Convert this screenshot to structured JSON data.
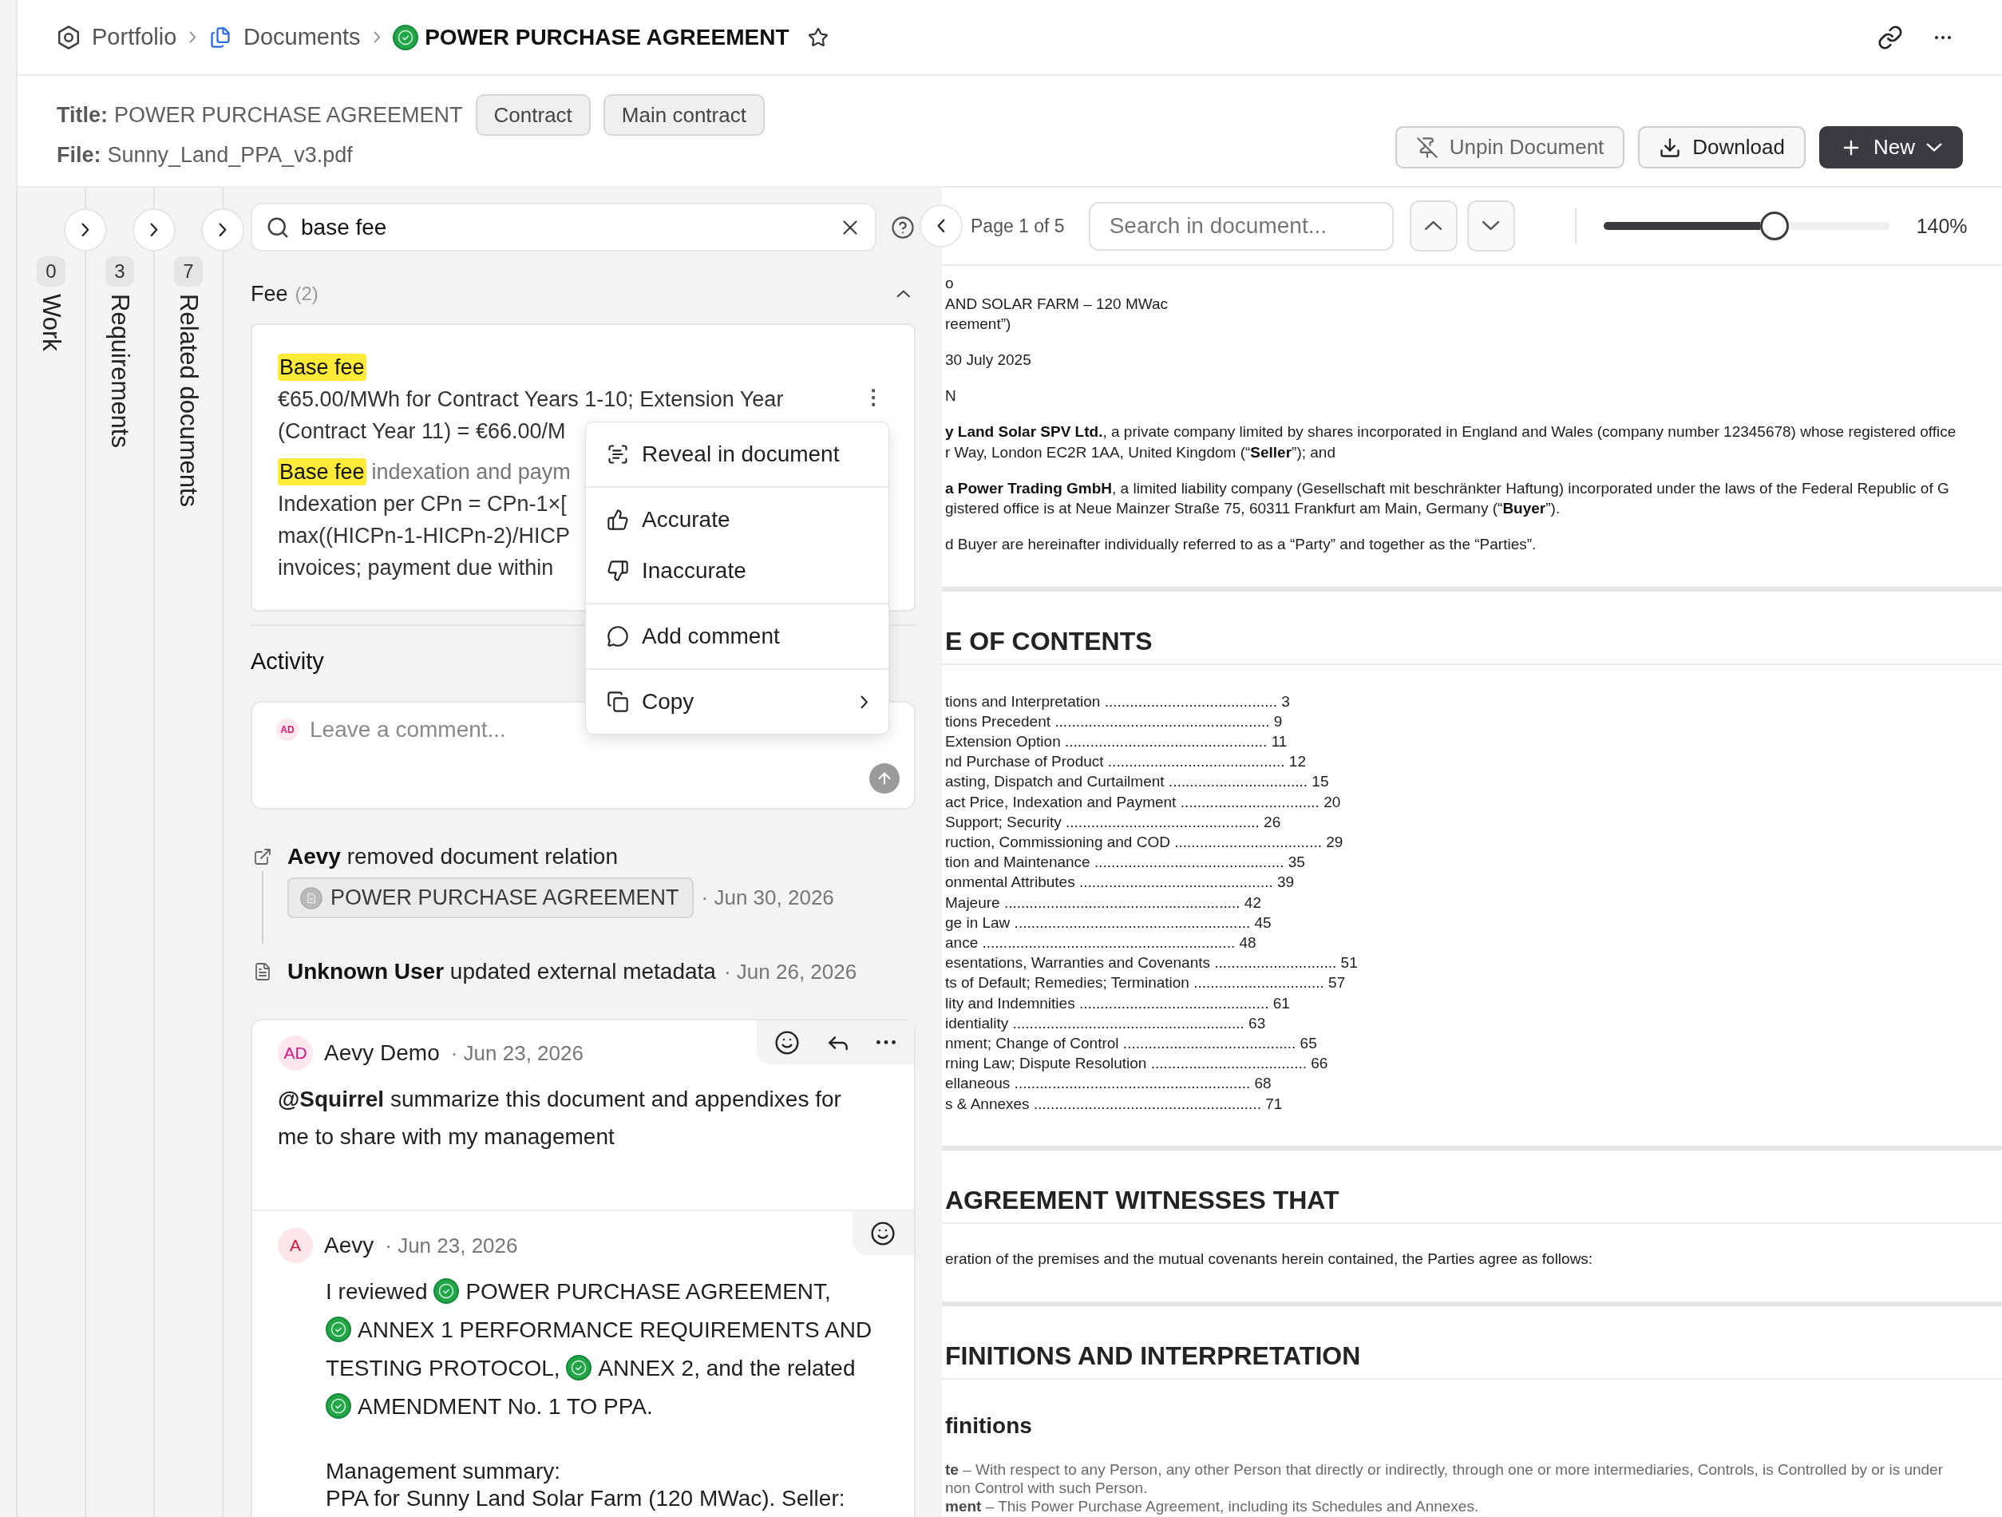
{
  "breadcrumb": {
    "items": [
      {
        "kind": "portfolio",
        "label": "Portfolio"
      },
      {
        "kind": "documents",
        "label": "Documents"
      },
      {
        "kind": "document",
        "label": "POWER PURCHASE AGREEMENT",
        "verified": true
      }
    ],
    "starred": false
  },
  "document_info": {
    "fields": [
      {
        "label": "Title:",
        "value": "POWER PURCHASE AGREEMENT",
        "tags": [
          "Contract",
          "Main contract"
        ]
      },
      {
        "label": "File:",
        "value": "Sunny_Land_PPA_v3.pdf"
      }
    ],
    "actions": [
      {
        "kind": "unpin",
        "label": "Unpin Document"
      },
      {
        "kind": "download",
        "label": "Download"
      },
      {
        "kind": "new",
        "label": "New"
      }
    ]
  },
  "side_tabs": [
    {
      "label": "Work",
      "count": "0"
    },
    {
      "label": "Requirements",
      "count": "3"
    },
    {
      "label": "Related documents",
      "count": "7"
    }
  ],
  "search": {
    "value": "base fee"
  },
  "result_groups": [
    {
      "title": "Fee",
      "count": "(2)",
      "expanded": true,
      "results": [
        {
          "highlight": "Base fee",
          "lines": [
            "€65.00/MWh for Contract Years 1-10; Extension Year",
            "(Contract Year 11) = €66.00/M"
          ],
          "menu_open": true
        },
        {
          "highlight": "Base fee",
          "heading": "indexation and paym",
          "lines": [
            "Indexation per CPn = CPn-1×[",
            "max((HICPn-1-HICPn-2)/HICP",
            "invoices; payment due within"
          ],
          "menu_open": false
        }
      ]
    }
  ],
  "context_menu": {
    "groups": [
      [
        {
          "kind": "reveal",
          "label": "Reveal in document",
          "submenu": false
        }
      ],
      [
        {
          "kind": "accurate",
          "label": "Accurate",
          "submenu": false
        },
        {
          "kind": "inaccurate",
          "label": "Inaccurate",
          "submenu": false
        }
      ],
      [
        {
          "kind": "comment",
          "label": "Add comment",
          "submenu": false
        }
      ],
      [
        {
          "kind": "copy",
          "label": "Copy",
          "submenu": true
        }
      ]
    ]
  },
  "activity": {
    "title": "Activity",
    "composer": {
      "avatar": "AD",
      "placeholder": "Leave a comment..."
    },
    "events": [
      {
        "kind": "relation",
        "text": "**Aevy** removed document relation",
        "chip": {
          "label": "POWER PURCHASE AGREEMENT",
          "verified": false
        },
        "date": "· Jun 30, 2026"
      },
      {
        "kind": "metadata",
        "text": "**Unknown User** updated external metadata",
        "date": "· Jun 26, 2026"
      }
    ],
    "comments": [
      {
        "kind": "message",
        "avatar": "AD",
        "author": "Aevy Demo",
        "date": "· Jun 23, 2026",
        "actions": [
          {
            "kind": "emoji"
          },
          {
            "kind": "reply"
          },
          {
            "kind": "more"
          }
        ],
        "body": [
          {
            "kind": "text",
            "text": "**@Squirrel** summarize this document and appendixes for me to share with my management"
          }
        ]
      },
      {
        "kind": "response",
        "avatar": "A",
        "author": "Aevy",
        "date": "· Jun 23, 2026",
        "actions": [
          {
            "kind": "emoji"
          }
        ],
        "body": [
          {
            "kind": "mentions",
            "parts": [
              {
                "kind": "text",
                "text": "I reviewed "
              },
              {
                "kind": "document",
                "text": "POWER PURCHASE AGREEMENT",
                "verified": true
              },
              {
                "kind": "text",
                "text": ", "
              },
              {
                "kind": "document",
                "text": "ANNEX 1 PERFORMANCE REQUIREMENTS AND TESTING PROTOCOL",
                "verified": true
              },
              {
                "kind": "text",
                "text": ", "
              },
              {
                "kind": "document",
                "text": "ANNEX 2",
                "verified": true
              },
              {
                "kind": "text",
                "text": ", and the related "
              },
              {
                "kind": "document",
                "text": "AMENDMENT No. 1 TO PPA",
                "verified": true
              },
              {
                "kind": "text",
                "text": "."
              }
            ]
          },
          {
            "kind": "lines",
            "lines": [
              "Management summary:",
              "PPA for Sunny Land Solar Farm (120 MWac). Seller:"
            ]
          }
        ]
      }
    ]
  },
  "viewer": {
    "page_label": "Page 1 of 5",
    "search_placeholder": "Search in document...",
    "zoom": {
      "level": 0.6,
      "reading": "140%"
    },
    "blocks": [
      {
        "kind": "lines",
        "lines": [
          "o",
          "AND SOLAR FARM – 120 MWac",
          "reement”)"
        ]
      },
      {
        "kind": "lines",
        "lines": [
          "30 July 2025"
        ]
      },
      {
        "kind": "lines",
        "lines": [
          "N"
        ]
      },
      {
        "kind": "lines",
        "lines": [
          "**y Land Solar SPV Ltd.**, a private company limited by shares incorporated in England and Wales (company number 12345678) whose registered office",
          "r Way, London EC2R 1AA, United Kingdom (“**Seller**”); and"
        ]
      },
      {
        "kind": "lines",
        "lines": [
          "**a Power Trading GmbH**, a limited liability company (Gesellschaft mit beschränkter Haftung) incorporated under the laws of the Federal Republic of G",
          "gistered office is at Neue Mainzer Straße 75, 60311 Frankfurt am Main, Germany (“**Buyer**”)."
        ]
      },
      {
        "kind": "lines",
        "lines": [
          "d Buyer are hereinafter individually referred to as a “Party” and together as the “Parties”."
        ]
      },
      {
        "kind": "page_break"
      },
      {
        "kind": "heading",
        "text": "E OF CONTENTS"
      },
      {
        "kind": "toc",
        "entries": [
          "tions and Interpretation ......................................... 3",
          "tions Precedent ................................................... 9",
          "Extension Option ................................................ 11",
          "nd Purchase of Product .......................................... 12",
          "asting, Dispatch and Curtailment ................................. 15",
          "act Price, Indexation and Payment ................................. 20",
          "Support; Security .............................................. 26",
          "ruction, Commissioning and COD ................................... 29",
          "tion and Maintenance ............................................. 35",
          "onmental Attributes .............................................. 39",
          "Majeure ........................................................ 42",
          "ge in Law ........................................................ 45",
          "ance ............................................................ 48",
          "esentations, Warranties and Covenants ............................. 51",
          "ts of Default; Remedies; Termination ............................... 57",
          "lity and Indemnities ............................................. 61",
          "identiality ....................................................... 63",
          "nment; Change of Control ......................................... 65",
          "rning Law; Dispute Resolution ..................................... 66",
          "ellaneous ........................................................ 68",
          "s & Annexes ...................................................... 71"
        ]
      },
      {
        "kind": "page_break"
      },
      {
        "kind": "heading",
        "text": "AGREEMENT WITNESSES THAT"
      },
      {
        "kind": "lines",
        "lines": [
          "eration of the premises and the mutual covenants herein contained, the Parties agree as follows:"
        ]
      },
      {
        "kind": "page_break"
      },
      {
        "kind": "heading",
        "text": "FINITIONS AND INTERPRETATION"
      },
      {
        "kind": "subheading",
        "text": "finitions"
      },
      {
        "kind": "definitions",
        "lines": [
          "**te** – With respect to any Person, any other Person that directly or indirectly, through one or more intermediaries, Controls, is Controlled by or is under",
          "non Control with such Person.",
          "**ment** – This Power Purchase Agreement, including its Schedules and Annexes."
        ]
      }
    ]
  }
}
